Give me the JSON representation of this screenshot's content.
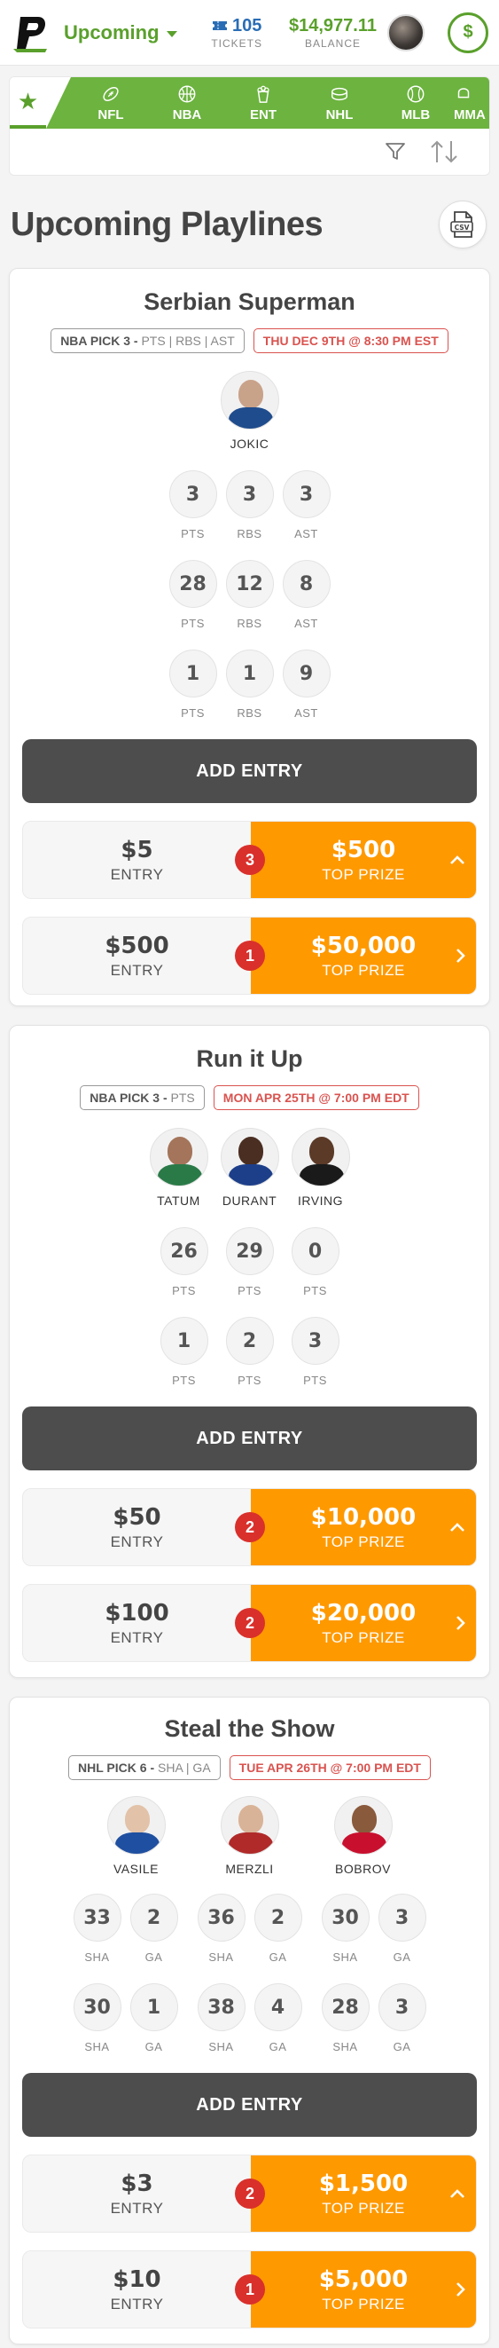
{
  "header": {
    "view": "Upcoming",
    "tickets_value": "105",
    "tickets_label": "TICKETS",
    "balance_value": "$14,977.11",
    "balance_label": "BALANCE",
    "wallet_icon": "$"
  },
  "sports": [
    "NFL",
    "NBA",
    "ENT",
    "NHL",
    "MLB",
    "MMA"
  ],
  "page": {
    "title": "Upcoming Playlines",
    "csv_label": "CSV"
  },
  "cards": [
    {
      "title": "Serbian Superman",
      "tag_league": "NBA PICK 3 -",
      "tag_stats": "PTS | RBS | AST",
      "date": "THU DEC 9TH @ 8:30 PM EST",
      "players": [
        "JOKIC"
      ],
      "rows": [
        [
          {
            "v": "3",
            "l": "PTS"
          },
          {
            "v": "3",
            "l": "RBS"
          },
          {
            "v": "3",
            "l": "AST"
          }
        ],
        [
          {
            "v": "28",
            "l": "PTS"
          },
          {
            "v": "12",
            "l": "RBS"
          },
          {
            "v": "8",
            "l": "AST"
          }
        ],
        [
          {
            "v": "1",
            "l": "PTS"
          },
          {
            "v": "1",
            "l": "RBS"
          },
          {
            "v": "9",
            "l": "AST"
          }
        ]
      ],
      "add_label": "ADD ENTRY",
      "entries": [
        {
          "amount": "$5",
          "entry_label": "ENTRY",
          "count": "3",
          "prize": "$500",
          "prize_label": "TOP PRIZE",
          "expanded": true
        },
        {
          "amount": "$500",
          "entry_label": "ENTRY",
          "count": "1",
          "prize": "$50,000",
          "prize_label": "TOP PRIZE",
          "expanded": false
        }
      ]
    },
    {
      "title": "Run it Up",
      "tag_league": "NBA PICK 3 -",
      "tag_stats": "PTS",
      "date": "MON APR 25TH @ 7:00 PM EDT",
      "players": [
        "TATUM",
        "DURANT",
        "IRVING"
      ],
      "rows": [
        [
          {
            "v": "26",
            "l": "PTS"
          },
          {
            "v": "29",
            "l": "PTS"
          },
          {
            "v": "0",
            "l": "PTS"
          }
        ],
        [
          {
            "v": "1",
            "l": "PTS"
          },
          {
            "v": "2",
            "l": "PTS"
          },
          {
            "v": "3",
            "l": "PTS"
          }
        ]
      ],
      "add_label": "ADD ENTRY",
      "entries": [
        {
          "amount": "$50",
          "entry_label": "ENTRY",
          "count": "2",
          "prize": "$10,000",
          "prize_label": "TOP PRIZE",
          "expanded": true
        },
        {
          "amount": "$100",
          "entry_label": "ENTRY",
          "count": "2",
          "prize": "$20,000",
          "prize_label": "TOP PRIZE",
          "expanded": false
        }
      ]
    },
    {
      "title": "Steal the Show",
      "tag_league": "NHL PICK 6 -",
      "tag_stats": "SHA | GA",
      "date": "TUE APR 26TH @ 7:00 PM EDT",
      "players": [
        "VASILE",
        "MERZLI",
        "BOBROV"
      ],
      "rows": [
        [
          {
            "v": "33",
            "l": "SHA"
          },
          {
            "v": "2",
            "l": "GA"
          },
          {
            "v": "36",
            "l": "SHA"
          },
          {
            "v": "2",
            "l": "GA"
          },
          {
            "v": "30",
            "l": "SHA"
          },
          {
            "v": "3",
            "l": "GA"
          }
        ],
        [
          {
            "v": "30",
            "l": "SHA"
          },
          {
            "v": "1",
            "l": "GA"
          },
          {
            "v": "38",
            "l": "SHA"
          },
          {
            "v": "4",
            "l": "GA"
          },
          {
            "v": "28",
            "l": "SHA"
          },
          {
            "v": "3",
            "l": "GA"
          }
        ]
      ],
      "add_label": "ADD ENTRY",
      "entries": [
        {
          "amount": "$3",
          "entry_label": "ENTRY",
          "count": "2",
          "prize": "$1,500",
          "prize_label": "TOP PRIZE",
          "expanded": true
        },
        {
          "amount": "$10",
          "entry_label": "ENTRY",
          "count": "1",
          "prize": "$5,000",
          "prize_label": "TOP PRIZE",
          "expanded": false
        }
      ]
    }
  ]
}
